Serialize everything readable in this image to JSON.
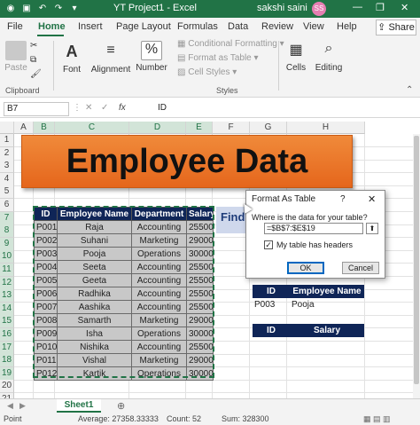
{
  "window": {
    "title": "YT Project1  -  Excel",
    "user_name": "sakshi saini",
    "avatar_initials": "SS",
    "accent_color": "#217346"
  },
  "menu": {
    "tabs": [
      "File",
      "Home",
      "Insert",
      "Page Layout",
      "Formulas",
      "Data",
      "Review",
      "View",
      "Help"
    ],
    "active_tab": "Home",
    "share_label": "Share"
  },
  "ribbon": {
    "paste_label": "Paste",
    "clipboard_group": "Clipboard",
    "font_label": "Font",
    "alignment_label": "Alignment",
    "number_label": "Number",
    "conditional_formatting": "Conditional Formatting",
    "format_as_table": "Format as Table",
    "cell_styles": "Cell Styles",
    "styles_group": "Styles",
    "cells_label": "Cells",
    "editing_label": "Editing"
  },
  "formula_bar": {
    "name_box": "B7",
    "fx_label": "fx",
    "formula": "ID"
  },
  "grid": {
    "columns": [
      "A",
      "B",
      "C",
      "D",
      "E",
      "F",
      "G",
      "H"
    ],
    "selected_columns": [
      "B",
      "C",
      "D",
      "E"
    ],
    "rows": [
      "1",
      "2",
      "3",
      "4",
      "5",
      "6",
      "7",
      "8",
      "9",
      "10",
      "11",
      "12",
      "13",
      "14",
      "15",
      "16",
      "17",
      "18",
      "19",
      "20",
      "21"
    ],
    "selected_rows": [
      "7",
      "8",
      "9",
      "10",
      "11",
      "12",
      "13",
      "14",
      "15",
      "16",
      "17",
      "18",
      "19"
    ]
  },
  "banner": {
    "text": "Employee Data",
    "color": "#f08a3a"
  },
  "employees": {
    "headers": [
      "ID",
      "Employee Name",
      "Department",
      "Salary"
    ],
    "rows": [
      [
        "P001",
        "Raja",
        "Accounting",
        "25500"
      ],
      [
        "P002",
        "Suhani",
        "Marketing",
        "29000"
      ],
      [
        "P003",
        "Pooja",
        "Operations",
        "30000"
      ],
      [
        "P004",
        "Seeta",
        "Accounting",
        "25500"
      ],
      [
        "P005",
        "Geeta",
        "Accounting",
        "25500"
      ],
      [
        "P006",
        "Radhika",
        "Accounting",
        "25500"
      ],
      [
        "P007",
        "Aashika",
        "Accounting",
        "25500"
      ],
      [
        "P008",
        "Samarth",
        "Marketing",
        "29000"
      ],
      [
        "P009",
        "Isha",
        "Operations",
        "30000"
      ],
      [
        "P010",
        "Nishika",
        "Accounting",
        "25500"
      ],
      [
        "P011",
        "Vishal",
        "Marketing",
        "29000"
      ],
      [
        "P012",
        "Kartik",
        "Operations",
        "30000"
      ]
    ]
  },
  "find_label": "Find",
  "lookup1": {
    "headers": [
      "ID",
      "Employee Name"
    ],
    "values": [
      "P003",
      "Pooja"
    ]
  },
  "lookup2": {
    "headers": [
      "ID",
      "Salary"
    ]
  },
  "dialog": {
    "title": "Format As Table",
    "help": "?",
    "close": "✕",
    "question": "Where is the data for your table?",
    "range": "=$B$7:$E$19",
    "has_headers_label": "My table has headers",
    "has_headers_checked": true,
    "ok_label": "OK",
    "cancel_label": "Cancel"
  },
  "sheets": {
    "tabs": [
      "Sheet1"
    ],
    "active": "Sheet1"
  },
  "status": {
    "mode": "Point",
    "average": "Average: 27358.33333",
    "count": "Count: 52",
    "sum": "Sum: 328300"
  }
}
